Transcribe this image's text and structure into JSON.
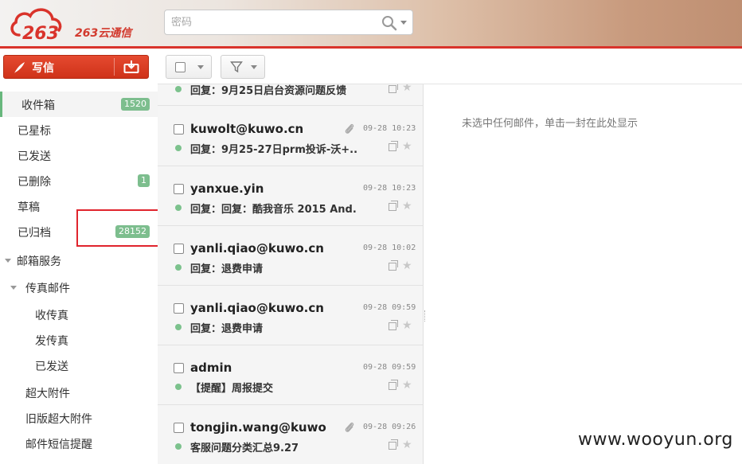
{
  "header": {
    "logo_text": "263云通信",
    "search_placeholder": "密码",
    "icons": [
      "cloud-logo",
      "search-icon",
      "chevron-down-icon"
    ]
  },
  "sidebar": {
    "compose_label": "写信",
    "folders": [
      {
        "label": "收件箱",
        "badge": "1520"
      },
      {
        "label": "已星标",
        "badge": ""
      },
      {
        "label": "已发送",
        "badge": ""
      },
      {
        "label": "已删除",
        "badge": "1"
      },
      {
        "label": "草稿",
        "badge": ""
      },
      {
        "label": "已归档",
        "badge": "28152"
      }
    ],
    "sections": [
      {
        "label": "邮箱服务"
      },
      {
        "label": "传真邮件"
      },
      {
        "label": "收传真"
      },
      {
        "label": "发传真"
      },
      {
        "label": "已发送"
      },
      {
        "label": "超大附件"
      },
      {
        "label": "旧版超大附件"
      },
      {
        "label": "邮件短信提醒"
      }
    ]
  },
  "mail_list": {
    "partial_subject": "回复：9月25日启台资源问题反馈",
    "items": [
      {
        "sender": "kuwolt@kuwo.cn",
        "date": "09-28 10:23",
        "subject": "回复：9月25-27日prm投诉-沃+...",
        "attachment": true
      },
      {
        "sender": "yanxue.yin",
        "date": "09-28 10:23",
        "subject": "回复：回复：酷我音乐 2015 And...",
        "attachment": false
      },
      {
        "sender": "yanli.qiao@kuwo.cn",
        "date": "09-28 10:02",
        "subject": "回复：退费申请",
        "attachment": false
      },
      {
        "sender": "yanli.qiao@kuwo.cn",
        "date": "09-28 09:59",
        "subject": "回复：退费申请",
        "attachment": false
      },
      {
        "sender": "admin",
        "date": "09-28 09:59",
        "subject": "【提醒】周报提交",
        "attachment": false
      },
      {
        "sender": "tongjin.wang@kuwo",
        "date": "09-28 09:26",
        "subject": "客服问题分类汇总9.27",
        "attachment": true
      }
    ]
  },
  "preview": {
    "empty_text": "未选中任何邮件，单击一封在此处显示"
  },
  "watermark": "www.wooyun.org",
  "colors": {
    "accent_red": "#d9332b",
    "badge_green": "#7dbe8e",
    "unread_dot": "#7cc28d",
    "highlight_box": "#e0242d"
  }
}
